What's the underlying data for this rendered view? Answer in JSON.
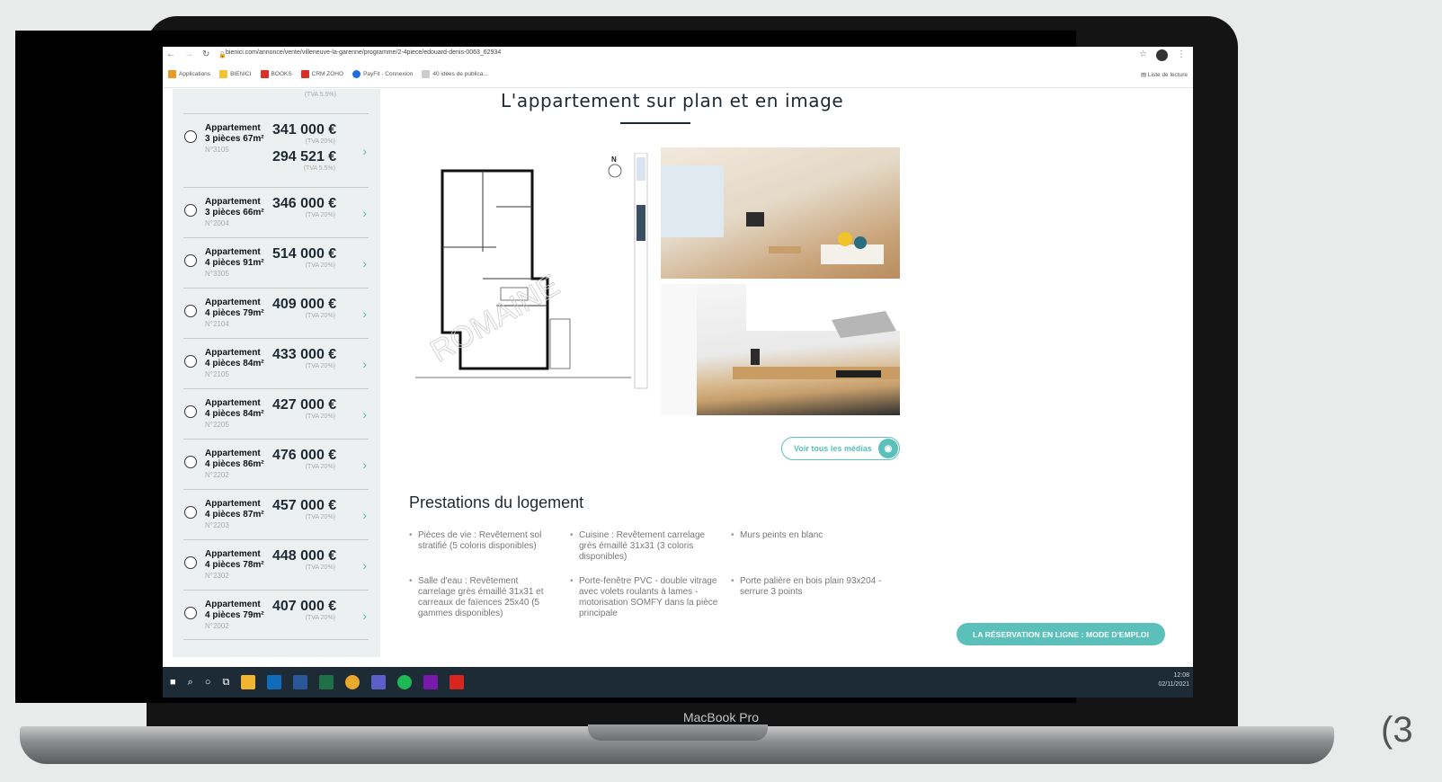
{
  "browser": {
    "url": "bienici.com/annonce/vente/villeneuve-la-garenne/programme/2-4piece/edouard-denis-0063_62934",
    "bookmarks": [
      "Applications",
      "BIENICI",
      "BOOKS",
      "CRM ZOHO",
      "PayFit · Connexion",
      "40 idées de publica..."
    ],
    "reading_list": "Liste de lecture"
  },
  "sidebar": {
    "top_tva": "(TVA 5.5%)",
    "listings": [
      {
        "type": "Appartement",
        "rooms": "3 pièces 67m²",
        "ref": "N°3105",
        "price": "341 000 €",
        "tva": "(TVA 20%)",
        "price2": "294 521 €",
        "tva2": "(TVA 5.5%)"
      },
      {
        "type": "Appartement",
        "rooms": "3 pièces 66m²",
        "ref": "N°2004",
        "price": "346 000 €",
        "tva": "(TVA 20%)"
      },
      {
        "type": "Appartement",
        "rooms": "4 pièces 91m²",
        "ref": "N°3305",
        "price": "514 000 €",
        "tva": "(TVA 20%)"
      },
      {
        "type": "Appartement",
        "rooms": "4 pièces 79m²",
        "ref": "N°2104",
        "price": "409 000 €",
        "tva": "(TVA 20%)"
      },
      {
        "type": "Appartement",
        "rooms": "4 pièces 84m²",
        "ref": "N°2105",
        "price": "433 000 €",
        "tva": "(TVA 20%)"
      },
      {
        "type": "Appartement",
        "rooms": "4 pièces 84m²",
        "ref": "N°2205",
        "price": "427 000 €",
        "tva": "(TVA 20%)"
      },
      {
        "type": "Appartement",
        "rooms": "4 pièces 86m²",
        "ref": "N°2202",
        "price": "476 000 €",
        "tva": "(TVA 20%)"
      },
      {
        "type": "Appartement",
        "rooms": "4 pièces 87m²",
        "ref": "N°2203",
        "price": "457 000 €",
        "tva": "(TVA 20%)"
      },
      {
        "type": "Appartement",
        "rooms": "4 pièces 78m²",
        "ref": "N°2302",
        "price": "448 000 €",
        "tva": "(TVA 20%)"
      },
      {
        "type": "Appartement",
        "rooms": "4 pièces 79m²",
        "ref": "N°2002",
        "price": "407 000 €",
        "tva": "(TVA 20%)"
      }
    ]
  },
  "main": {
    "section_title": "L'appartement sur plan et en image",
    "watermark": "ROMAINE",
    "media_button": "Voir tous les médias",
    "prestations_title": "Prestations du logement",
    "prestations": [
      "Pièces de vie : Revêtement sol stratifié (5 coloris disponibles)",
      "Cuisine : Revêtement carrelage grès émaillé 31x31 (3 coloris disponibles)",
      "Murs peints en blanc",
      "Salle d'eau : Revêtement carrelage grès émaillé 31x31 et carreaux de faïences 25x40 (5 gammes disponibles)",
      "Porte-fenêtre PVC - double vitrage avec volets roulants à lames - motorisation SOMFY dans la pièce principale",
      "Porte palière en bois plain 93x204 - serrure 3 points"
    ],
    "cta": "LA RÉSERVATION EN LIGNE : MODE D'EMPLOI"
  },
  "taskbar": {
    "time": "12:08",
    "date": "02/11/2021"
  },
  "device_label": "MacBook Pro",
  "corner_text": "(3",
  "colors": {
    "accent": "#5bc0b9",
    "sidebar_bg": "#edf0f1",
    "taskbar": "#1d2b36"
  }
}
